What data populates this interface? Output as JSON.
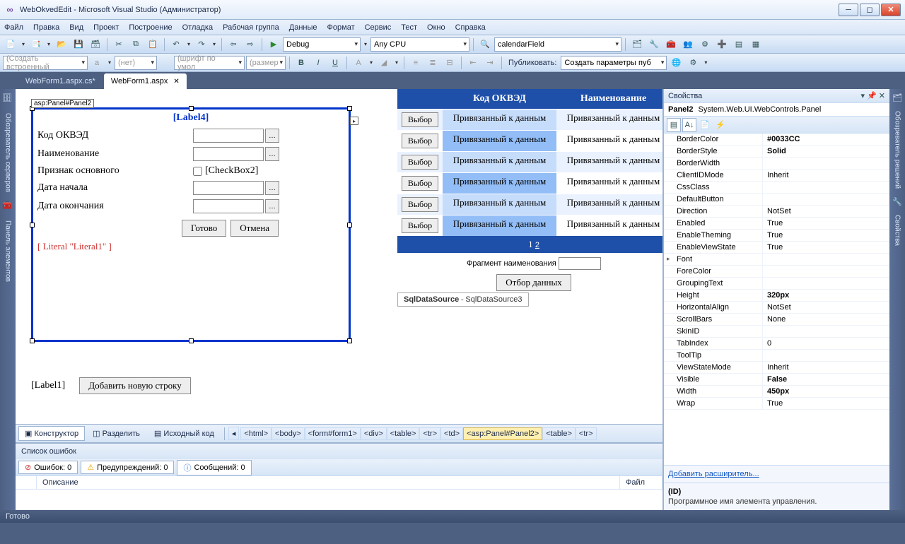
{
  "title": "WebOkvedEdit - Microsoft Visual Studio (Администратор)",
  "menu": [
    "Файл",
    "Правка",
    "Вид",
    "Проект",
    "Построение",
    "Отладка",
    "Рабочая группа",
    "Данные",
    "Формат",
    "Сервис",
    "Тест",
    "Окно",
    "Справка"
  ],
  "toolbar1": {
    "config": "Debug",
    "platform": "Any CPU",
    "find": "calendarField"
  },
  "toolbar2": {
    "style": "(Создать встроенный",
    "ruleopts": "(нет)",
    "font": "(шрифт по умол",
    "size": "(размер",
    "publish_label": "Публиковать:",
    "publish_target": "Создать параметры пуб"
  },
  "tabs": [
    {
      "label": "WebForm1.aspx.cs*",
      "active": false
    },
    {
      "label": "WebForm1.aspx",
      "active": true
    }
  ],
  "left_tabs": [
    "Обозреватель серверов",
    "Панель элементов"
  ],
  "right_tabs": [
    "Обозреватель решений",
    "Свойства"
  ],
  "panel": {
    "tag": "asp:Panel#Panel2",
    "heading": "[Label4]",
    "rows": [
      {
        "label": "Код ОКВЭД",
        "pick": true
      },
      {
        "label": "Наименование",
        "pick": true
      },
      {
        "label": "Признак основного",
        "cb": "[CheckBox2]"
      },
      {
        "label": "Дата начала",
        "pick": true
      },
      {
        "label": "Дата окончания",
        "pick": true
      }
    ],
    "btn_ok": "Готово",
    "btn_cancel": "Отмена",
    "literal": "[ Literal \"Literal1\" ]"
  },
  "below": {
    "label": "[Label1]",
    "addrow": "Добавить новую строку"
  },
  "grid": {
    "headers": [
      "",
      "Код ОКВЭД",
      "Наименование"
    ],
    "select": "Выбор",
    "bound": "Привязанный к данным",
    "pager": "1 2",
    "fragment": "Фрагмент наименования",
    "filter_btn": "Отбор данных",
    "sds_label": "SqlDataSource",
    "sds_id": "SqlDataSource3"
  },
  "viewbar": {
    "design": "Конструктор",
    "split": "Разделить",
    "source": "Исходный код",
    "crumbs": [
      "<html>",
      "<body>",
      "<form#form1>",
      "<div>",
      "<table>",
      "<tr>",
      "<td>",
      "<asp:Panel#Panel2>",
      "<table>",
      "<tr>"
    ]
  },
  "errorlist": {
    "title": "Список ошибок",
    "errors": "Ошибок: 0",
    "warnings": "Предупреждений: 0",
    "messages": "Сообщений: 0",
    "col_desc": "Описание",
    "col_file": "Файл"
  },
  "props": {
    "title": "Свойства",
    "object_name": "Panel2",
    "object_type": "System.Web.UI.WebControls.Panel",
    "rows": [
      [
        "BorderColor",
        "#0033CC",
        true
      ],
      [
        "BorderStyle",
        "Solid",
        true
      ],
      [
        "BorderWidth",
        "",
        false
      ],
      [
        "ClientIDMode",
        "Inherit",
        false
      ],
      [
        "CssClass",
        "",
        false
      ],
      [
        "DefaultButton",
        "",
        false
      ],
      [
        "Direction",
        "NotSet",
        false
      ],
      [
        "Enabled",
        "True",
        false
      ],
      [
        "EnableTheming",
        "True",
        false
      ],
      [
        "EnableViewState",
        "True",
        false
      ],
      [
        "Font",
        "",
        false
      ],
      [
        "ForeColor",
        "",
        false
      ],
      [
        "GroupingText",
        "",
        false
      ],
      [
        "Height",
        "320px",
        true
      ],
      [
        "HorizontalAlign",
        "NotSet",
        false
      ],
      [
        "ScrollBars",
        "None",
        false
      ],
      [
        "SkinID",
        "",
        false
      ],
      [
        "TabIndex",
        "0",
        false
      ],
      [
        "ToolTip",
        "",
        false
      ],
      [
        "ViewStateMode",
        "Inherit",
        false
      ],
      [
        "Visible",
        "False",
        true
      ],
      [
        "Width",
        "450px",
        true
      ],
      [
        "Wrap",
        "True",
        false
      ]
    ],
    "link": "Добавить расширитель...",
    "desc_head": "(ID)",
    "desc_text": "Программное имя элемента управления."
  },
  "status": "Готово"
}
